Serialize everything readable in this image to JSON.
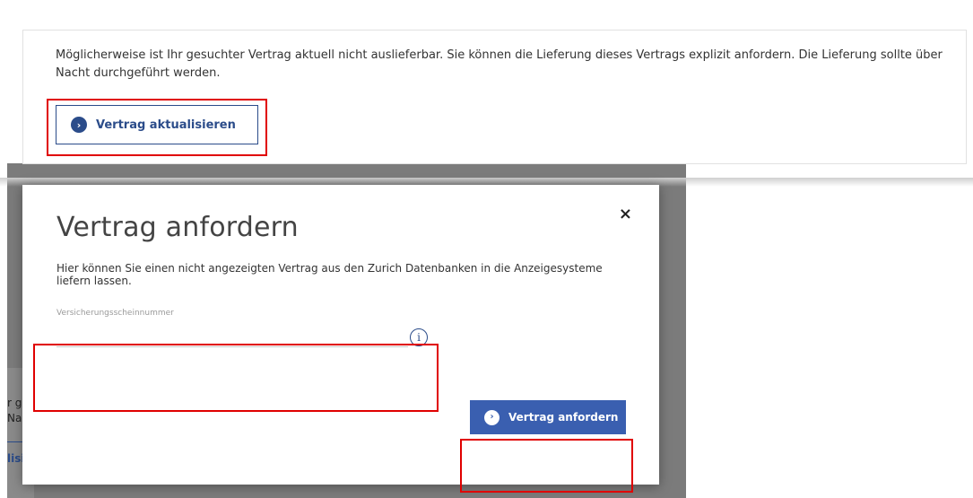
{
  "notice": {
    "text": "Möglicherweise ist Ihr gesuchter Vertrag aktuell nicht auslieferbar. Sie können die Lieferung dieses Vertrags explizit anfordern. Die Lieferung sollte über Nacht durchgeführt werden.",
    "button_label": "Vertrag aktualisieren"
  },
  "background": {
    "fragment_1": "r g",
    "fragment_2": "Na",
    "fragment_3": "lisi"
  },
  "modal": {
    "title": "Vertrag anfordern",
    "close_glyph": "×",
    "description": "Hier können Sie einen nicht angezeigten Vertrag aus den Zurich Datenbanken in die Anzeigesysteme liefern lassen.",
    "field_label": "Versicherungsscheinnummer",
    "field_value": "",
    "info_glyph": "i",
    "submit_label": "Vertrag anfordern"
  },
  "icons": {
    "chevron": "chevron-right-icon",
    "close": "close-icon",
    "info": "info-icon"
  },
  "colors": {
    "brand_blue": "#2b4c8a",
    "primary_button": "#3a5fb0",
    "annotation_red": "#e00000"
  }
}
